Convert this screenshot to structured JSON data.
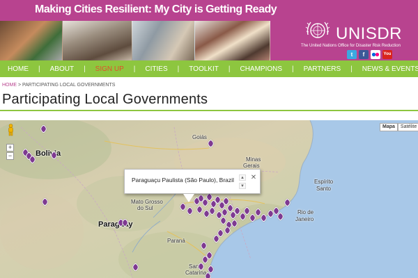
{
  "header": {
    "title": "Making Cities Resilient: My City is Getting Ready",
    "brand": "UNISDR",
    "brand_subtitle": "The United Nations Office for Disaster Risk Reduction",
    "social_icons": [
      "twitter-icon",
      "facebook-icon",
      "flickr-icon",
      "youtube-icon"
    ],
    "social_labels": {
      "twitter": "t",
      "facebook": "f",
      "flickr": "••",
      "youtube": "You Tube"
    }
  },
  "nav": {
    "items": [
      {
        "label": "HOME",
        "active": false
      },
      {
        "label": "ABOUT",
        "active": false
      },
      {
        "label": "SIGN UP",
        "active": true
      },
      {
        "label": "CITIES",
        "active": false
      },
      {
        "label": "TOOLKIT",
        "active": false
      },
      {
        "label": "CHAMPIONS",
        "active": false
      },
      {
        "label": "PARTNERS",
        "active": false
      },
      {
        "label": "NEWS & EVENTS",
        "active": false
      }
    ],
    "separator": "|"
  },
  "breadcrumb": {
    "home": "HOME",
    "sep": " > ",
    "current": "PARTICIPATING LOCAL GOVERNMENTS"
  },
  "page_title": "Participating Local Governments",
  "map": {
    "map_type_buttons": [
      "Mapa",
      "Satélite"
    ],
    "zoom_in": "+",
    "zoom_out": "−",
    "info_window_text": "Paraguaçu Paulista (São Paulo), Brazil",
    "info_scroll_up": "▲",
    "info_scroll_down": "▼",
    "info_close": "✕",
    "labels": {
      "bolivia": "Bolivia",
      "goias": "Goiás",
      "minas_gerais_1": "Minas",
      "minas_gerais_2": "Gerais",
      "espirito_santo_1": "Espírito",
      "espirito_santo_2": "Santo",
      "mato_grosso_1": "Mato Grosso",
      "mato_grosso_2": "do Sul",
      "paraguay": "Paraguay",
      "parana": "Paraná",
      "rio_1": "Rio de",
      "rio_2": "Janeiro",
      "santa_catarina_1": "Santa",
      "santa_catarina_2": "Catarina"
    }
  },
  "colors": {
    "header_magenta": "#b8438f",
    "nav_green": "#8dc63f",
    "active_nav": "#e0502b",
    "marker_purple": "#7e3a91",
    "ocean_blue": "#a8c8e8"
  }
}
